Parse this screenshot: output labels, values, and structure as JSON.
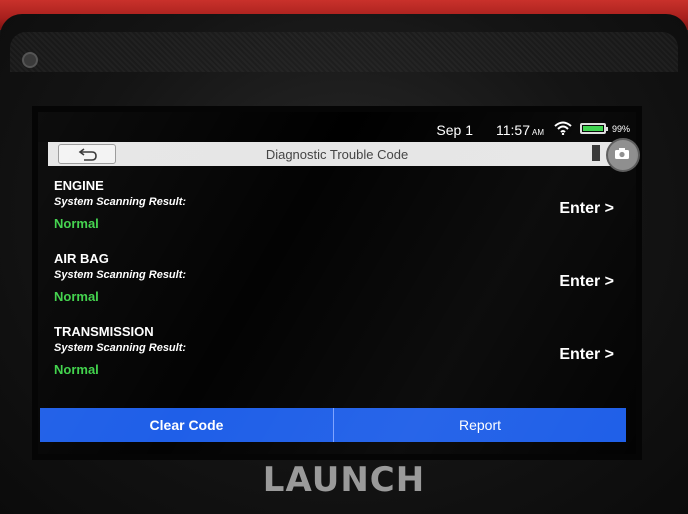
{
  "status_bar": {
    "date": "Sep 1",
    "time": "11:57",
    "ampm": "AM",
    "battery": "99%",
    "battery_level": 0.99
  },
  "header": {
    "title": "Diagnostic Trouble Code"
  },
  "systems": [
    {
      "name": "ENGINE",
      "sub": "System Scanning Result:",
      "status": "Normal",
      "action": "Enter >"
    },
    {
      "name": "AIR BAG",
      "sub": "System Scanning Result:",
      "status": "Normal",
      "action": "Enter >"
    },
    {
      "name": "TRANSMISSION",
      "sub": "System Scanning Result:",
      "status": "Normal",
      "action": "Enter >"
    }
  ],
  "footer": {
    "clear_label": "Clear Code",
    "report_label": "Report"
  },
  "device": {
    "brand": "LAUNCH"
  },
  "colors": {
    "accent_blue": "#1f5fe8",
    "status_green": "#3fd24a",
    "device_red": "#c9312b"
  }
}
